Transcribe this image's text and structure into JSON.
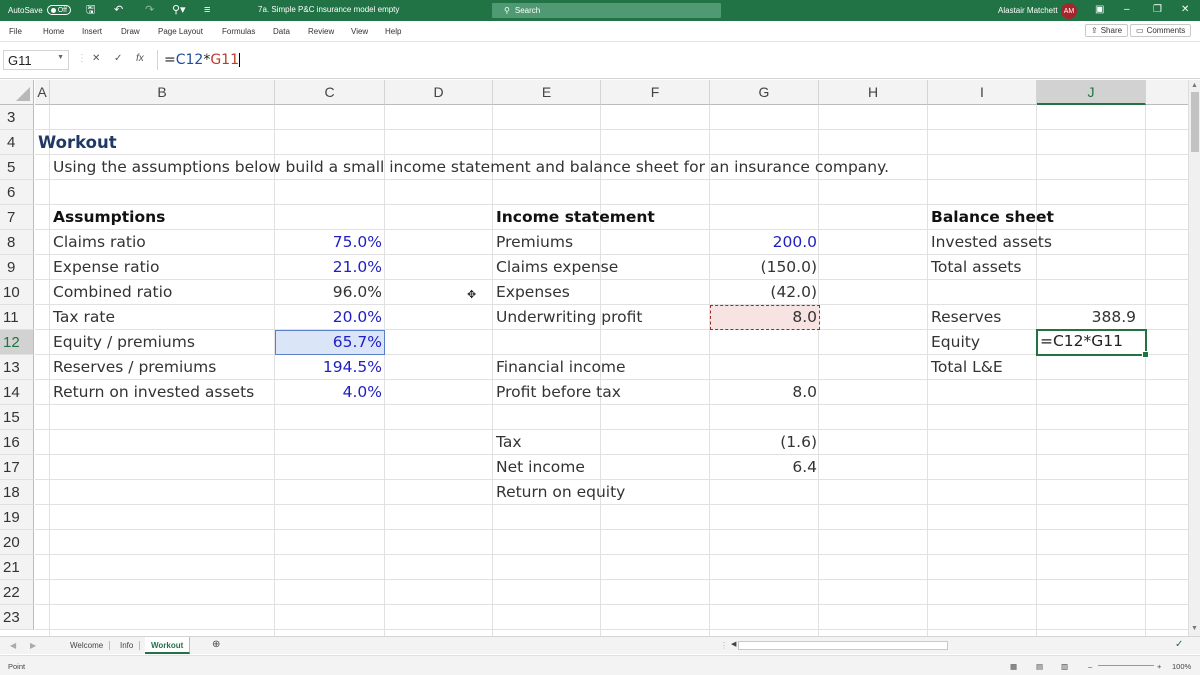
{
  "titlebar": {
    "autosave_label": "AutoSave",
    "autosave_state": "Off",
    "doc_title": "7a. Simple P&C insurance model empty",
    "search_placeholder": "Search",
    "user_name": "Alastair Matchett",
    "user_initials": "AM"
  },
  "menu": {
    "file": "File",
    "home": "Home",
    "insert": "Insert",
    "draw": "Draw",
    "page_layout": "Page Layout",
    "formulas": "Formulas",
    "data": "Data",
    "review": "Review",
    "view": "View",
    "help": "Help",
    "share": "Share",
    "comments": "Comments"
  },
  "formula_bar": {
    "name_box": "G11",
    "fx": "fx",
    "formula_prefix": "=",
    "formula_ref1": "C12",
    "formula_op": "*",
    "formula_ref2": "G11"
  },
  "columns": [
    "A",
    "B",
    "C",
    "D",
    "E",
    "F",
    "G",
    "H",
    "I",
    "J"
  ],
  "rows": [
    "3",
    "4",
    "5",
    "6",
    "7",
    "8",
    "9",
    "10",
    "11",
    "12",
    "13",
    "14",
    "15",
    "16",
    "17",
    "18",
    "19",
    "20",
    "21",
    "22",
    "23"
  ],
  "sheet": {
    "heading": "Workout",
    "instructions": "Using the assumptions below build a small income statement and balance sheet for an insurance company.",
    "assumptions": {
      "title": "Assumptions",
      "items": [
        {
          "label": "Claims ratio",
          "value": "75.0%"
        },
        {
          "label": "Expense ratio",
          "value": "21.0%"
        },
        {
          "label": "Combined ratio",
          "value": "96.0%"
        },
        {
          "label": "Tax rate",
          "value": "20.0%"
        },
        {
          "label": "Equity / premiums",
          "value": "65.7%"
        },
        {
          "label": "Reserves / premiums",
          "value": "194.5%"
        },
        {
          "label": "Return on invested assets",
          "value": "4.0%"
        }
      ]
    },
    "income_statement": {
      "title": "Income statement",
      "premiums": {
        "label": "Premiums",
        "value": "200.0"
      },
      "claims": {
        "label": "Claims expense",
        "value": "(150.0)"
      },
      "expenses": {
        "label": "Expenses",
        "value": "(42.0)"
      },
      "uw_profit": {
        "label": "Underwriting profit",
        "value": "8.0"
      },
      "fin_income": {
        "label": "Financial income"
      },
      "pbt": {
        "label": "Profit before tax",
        "value": "8.0"
      },
      "tax": {
        "label": "Tax",
        "value": "(1.6)"
      },
      "net_income": {
        "label": "Net income",
        "value": "6.4"
      },
      "roe": {
        "label": "Return on equity"
      }
    },
    "balance_sheet": {
      "title": "Balance sheet",
      "invested_assets": "Invested assets",
      "total_assets": "Total assets",
      "reserves": {
        "label": "Reserves",
        "value": "388.9"
      },
      "equity": {
        "label": "Equity",
        "editing": "=C12*G11"
      },
      "total_le": "Total L&E"
    }
  },
  "tabs": [
    "Welcome",
    "Info",
    "Workout"
  ],
  "status": {
    "mode": "Point",
    "zoom": "100%"
  },
  "colors": {
    "excel_green": "#217346",
    "input_blue": "#1f1fc2",
    "heading_navy": "#1f3864"
  }
}
